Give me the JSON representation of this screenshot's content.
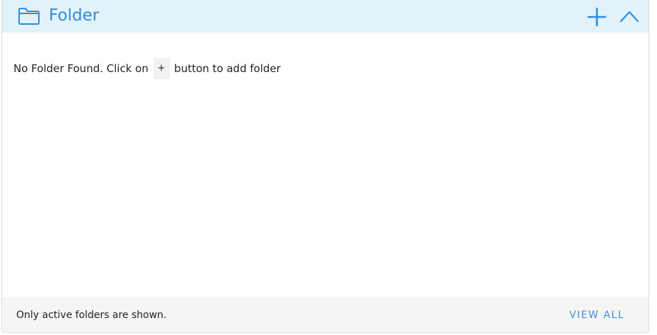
{
  "panel": {
    "title": "Folder",
    "icon": "folder-icon",
    "actions": {
      "add_icon": "plus-icon",
      "collapse_icon": "chevron-up-icon"
    }
  },
  "empty_state": {
    "prefix": "No Folder Found. Click on",
    "button_glyph": "+",
    "suffix": "button to add folder"
  },
  "footer": {
    "note": "Only active folders are shown.",
    "view_all_label": "VIEW ALL"
  },
  "colors": {
    "accent": "#2a8fe0",
    "header_bg": "#e3f1fb",
    "footer_bg": "#f5f5f5"
  }
}
